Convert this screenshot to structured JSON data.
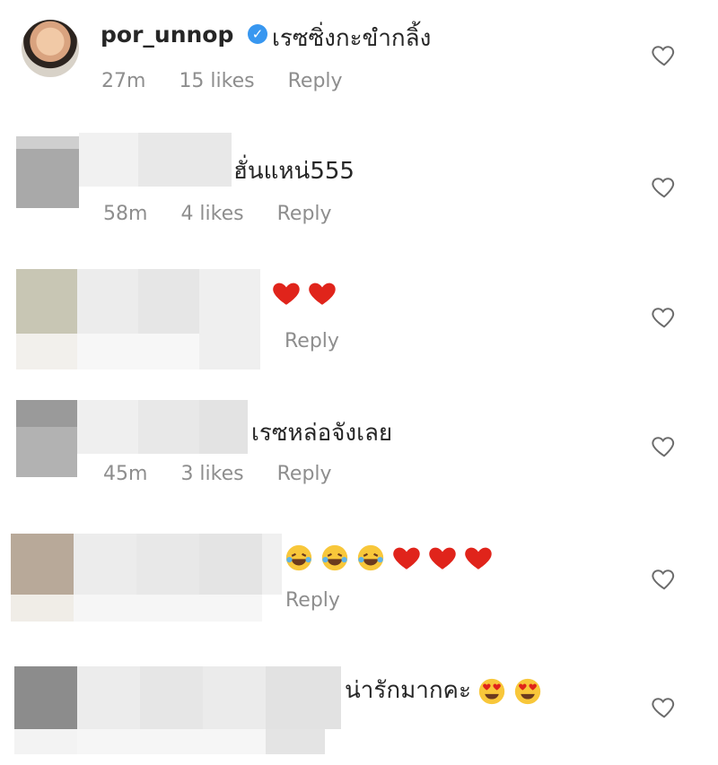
{
  "comments": [
    {
      "username": "por_unnop",
      "verified": true,
      "text": "เรซซิ่งกะขำกลิ้ง",
      "time": "27m",
      "likes": "15 likes",
      "reply": "Reply"
    },
    {
      "text": "ฮั่นแหน่555",
      "time": "58m",
      "likes": "4 likes",
      "reply": "Reply"
    },
    {
      "emoji": [
        "red-heart",
        "red-heart"
      ],
      "reply": "Reply"
    },
    {
      "text": "เรซหล่อจังเลย",
      "time": "45m",
      "likes": "3 likes",
      "reply": "Reply"
    },
    {
      "emoji": [
        "tears-of-joy",
        "tears-of-joy",
        "tears-of-joy",
        "red-heart",
        "red-heart",
        "red-heart"
      ],
      "reply": "Reply"
    },
    {
      "text": "น่ารักมากคะ",
      "emoji": [
        "heart-eyes",
        "heart-eyes"
      ]
    }
  ],
  "colors": {
    "meta_gray": "#8e8e8e",
    "verified_blue": "#3897f0",
    "heart_red": "#e0241b"
  }
}
